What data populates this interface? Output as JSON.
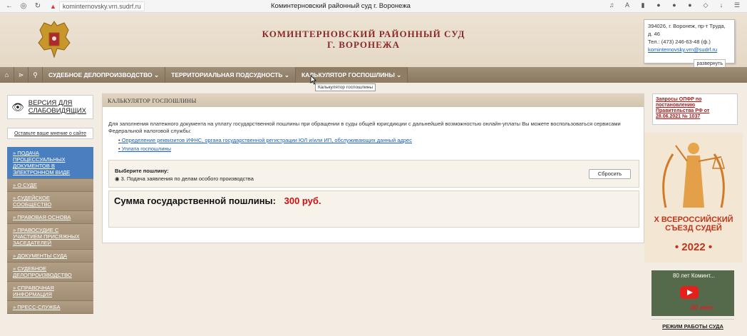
{
  "browser": {
    "url": "kominternovsky.vrn.sudrf.ru",
    "tab_title": "Коминтерновский районный суд г. Воронежа"
  },
  "header": {
    "title_line1": "КОМИНТЕРНОВСКИЙ РАЙОННЫЙ СУД",
    "title_line2": "Г. ВОРОНЕЖА",
    "contact": {
      "address": "394026, г. Воронеж, пр-т Труда, д. 46",
      "phone": "Тел.: (473) 246-63-48 (ф.)",
      "email": "kominternovsky.vrn@sudrf.ru",
      "expand": "развернуть"
    }
  },
  "menu": {
    "items": [
      "СУДЕБНОЕ ДЕЛОПРОИЗВОДСТВО",
      "ТЕРРИТОРИАЛЬНАЯ ПОДСУДНОСТЬ",
      "КАЛЬКУЛЯТОР ГОСПОШЛИНЫ"
    ],
    "tooltip": "Калькулятор госпошлины"
  },
  "sidebar": {
    "vision": "ВЕРСИЯ ДЛЯ СЛАБОВИДЯЩИХ",
    "feedback": "Оставьте ваше мнение о сайте",
    "items": [
      "ПОДАЧА ПРОЦЕССУАЛЬНЫХ ДОКУМЕНТОВ В ЭЛЕКТРОННОМ ВИДЕ",
      "О СУДЕ",
      "СУДЕЙСКОЕ СООБЩЕСТВО",
      "ПРАВОВАЯ ОСНОВА",
      "ПРАВОСУДИЕ С УЧАСТИЕМ ПРИСЯЖНЫХ ЗАСЕДАТЕЛЕЙ",
      "ДОКУМЕНТЫ СУДА",
      "СУДЕБНОЕ ДЕЛОПРОИЗВОДСТВО",
      "СПРАВОЧНАЯ ИНФОРМАЦИЯ",
      "ПРЕСС-СЛУЖБА"
    ]
  },
  "main": {
    "title": "КАЛЬКУЛЯТОР ГОСПОШЛИНЫ",
    "intro": "Для заполнения платежного документа на уплату государственной пошлины при обращении в суды общей юрисдикции с дальнейшей возможностью онлайн-уплаты Вы можете воспользоваться сервисами Федеральной налоговой службы:",
    "links": [
      "Определение реквизитов ИФНС, органа государственной регистрации ЮЛ и/или ИП, обслуживающих данный адрес",
      "Уплата госпошлины"
    ],
    "choose_label": "Выберите пошлину:",
    "selected_option": "3. Подача заявления по делам особого производства",
    "reset": "Сбросить",
    "sum_label": "Сумма государственной пошлины:",
    "sum_value": "300 руб."
  },
  "right": {
    "notice": "Запросы ОПФР по постановлению Правительства РФ от 28.06.2021 № 1037",
    "congress_text": "X ВСЕРОССИЙСКИЙ СЪЕЗД СУДЕЙ",
    "congress_year": "• 2022 •",
    "video_title": "80 лет Коминт...",
    "video_stamp": "80 лет",
    "schedule": "РЕЖИМ РАБОТЫ СУДА"
  }
}
